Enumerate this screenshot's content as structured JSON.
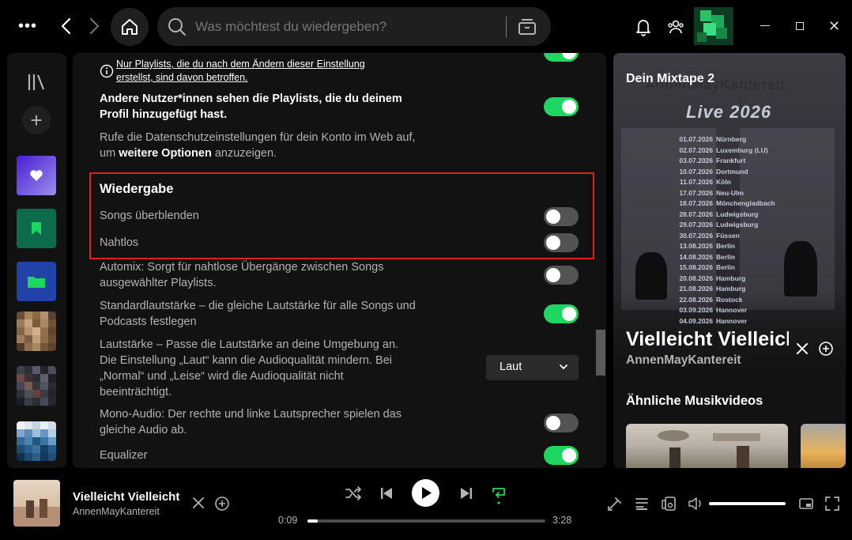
{
  "topbar": {
    "more_icon": "more-dots-icon",
    "search_placeholder": "Was möchtest du wiedergeben?"
  },
  "sidebar": {
    "items": [
      {
        "name": "liked-songs",
        "icon": "heart-icon",
        "color": "#5b2fe0"
      },
      {
        "name": "saved-episodes",
        "icon": "bookmark-icon",
        "color": "#0b6b4b"
      },
      {
        "name": "folder",
        "icon": "folder-icon",
        "color": "#2142a6"
      }
    ]
  },
  "settings": {
    "info_note": "Nur Playlists, die du nach dem Ändern dieser Einstellung erstellst, sind davon betroffen.",
    "profile_playlists": {
      "label": "Andere Nutzer*innen sehen die Playlists, die du deinem Profil hinzugefügt hast.",
      "on": true
    },
    "privacy_text_1": "Rufe die Datenschutzeinstellungen für dein Konto im Web auf, um",
    "privacy_text_bold": "weitere Optionen",
    "privacy_text_2": "anzuzeigen.",
    "playback_title": "Wiedergabe",
    "crossfade": {
      "label": "Songs überblenden",
      "on": false
    },
    "gapless": {
      "label": "Nahtlos",
      "on": false
    },
    "automix": {
      "label": "Automix: Sorgt für nahtlose Übergänge zwischen Songs ausgewählter Playlists.",
      "on": false
    },
    "normalize": {
      "label": "Standardlautstärke – die gleiche Lautstärke für alle Songs und Podcasts festlegen",
      "on": true
    },
    "loudness": {
      "label": "Lautstärke – Passe die Lautstärke an deine Umgebung an. Die Einstellung „Laut“ kann die Audioqualität mindern. Bei „Normal“ und „Leise“ wird die Audioqualität nicht beeinträchtigt.",
      "value": "Laut"
    },
    "mono": {
      "label": "Mono-Audio: Der rechte und linke Lautsprecher spielen das gleiche Audio ab.",
      "on": false
    },
    "equalizer": {
      "label": "Equalizer",
      "on": true
    }
  },
  "right_panel": {
    "title": "Dein Mixtape 2",
    "cover_band": "AnnenMayKantereit",
    "cover_live": "Live 2026",
    "tour": [
      {
        "date": "01.07.2026",
        "city": "Nürnberg"
      },
      {
        "date": "02.07.2026",
        "city": "Luxemburg (LU)"
      },
      {
        "date": "03.07.2026",
        "city": "Frankfurt"
      },
      {
        "date": "10.07.2026",
        "city": "Dortmund"
      },
      {
        "date": "11.07.2026",
        "city": "Köln"
      },
      {
        "date": "17.07.2026",
        "city": "Neu-Ulm"
      },
      {
        "date": "18.07.2026",
        "city": "Mönchengladbach"
      },
      {
        "date": "28.07.2026",
        "city": "Ludwigsburg"
      },
      {
        "date": "29.07.2026",
        "city": "Ludwigsburg"
      },
      {
        "date": "30.07.2026",
        "city": "Füssen"
      },
      {
        "date": "13.08.2026",
        "city": "Berlin"
      },
      {
        "date": "14.08.2026",
        "city": "Berlin"
      },
      {
        "date": "15.08.2026",
        "city": "Berlin"
      },
      {
        "date": "20.08.2026",
        "city": "Hamburg"
      },
      {
        "date": "21.08.2026",
        "city": "Hamburg"
      },
      {
        "date": "22.08.2026",
        "city": "Rostock"
      },
      {
        "date": "03.09.2026",
        "city": "Hannover"
      },
      {
        "date": "04.09.2026",
        "city": "Hannover"
      }
    ],
    "song_title": "Vielleicht Vielleicht",
    "artist": "AnnenMayKantereit",
    "similar_title": "Ähnliche Musikvideos"
  },
  "player": {
    "track_title": "Vielleicht Vielleicht",
    "artist": "AnnenMayKantereit",
    "time_current": "0:09",
    "time_total": "3:28",
    "progress_fraction": 0.043,
    "volume_fraction": 1.0,
    "accent": "#1ed760"
  }
}
